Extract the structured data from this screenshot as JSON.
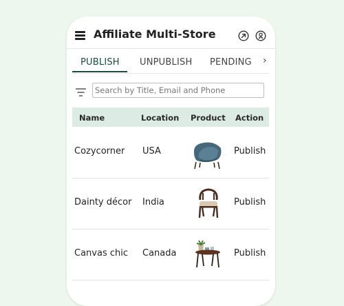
{
  "app": {
    "title": "Affiliate Multi-Store"
  },
  "icons": {
    "menu": "hamburger-menu-icon",
    "open_external": "arrow-up-right-circle-icon",
    "account": "user-circle-icon",
    "filter": "filter-icon",
    "tabs_more": "chevron-right-icon"
  },
  "tabs": [
    {
      "label": "PUBLISH",
      "active": true
    },
    {
      "label": "UNPUBLISH",
      "active": false
    },
    {
      "label": "PENDING",
      "active": false
    }
  ],
  "tabs_more_glyph": "›",
  "search": {
    "placeholder": "Search by Title, Email and Phone",
    "value": ""
  },
  "table": {
    "headers": [
      "Name",
      "Location",
      "Product",
      "Action"
    ],
    "rows": [
      {
        "name": "Cozycorner",
        "location": "USA",
        "product_image": "blue-armchair",
        "action": "Publish"
      },
      {
        "name": "Dainty décor",
        "location": "India",
        "product_image": "wooden-chair",
        "action": "Publish"
      },
      {
        "name": "Canvas chic",
        "location": "Canada",
        "product_image": "side-table-with-plant",
        "action": "Publish"
      }
    ]
  },
  "colors": {
    "page_background": "#eef7ee",
    "accent": "#1d4a3a",
    "table_header_background": "#dcece4"
  }
}
